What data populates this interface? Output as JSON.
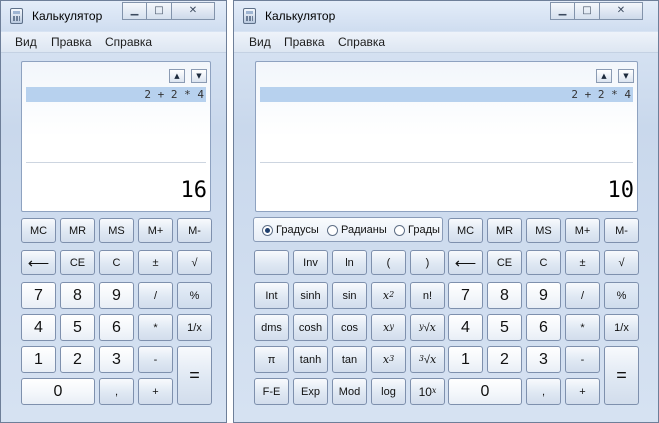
{
  "windows": [
    {
      "title": "Калькулятор",
      "menu": [
        "Вид",
        "Правка",
        "Справка"
      ],
      "display": {
        "history_up": "▲",
        "history_down": "▼",
        "history_expression": "2 + 2 * 4",
        "result": "16"
      },
      "keys": {
        "mc": "MC",
        "mr": "MR",
        "ms": "MS",
        "mplus": "M+",
        "mminus": "M-",
        "backspace": "⟵",
        "ce": "CE",
        "c": "C",
        "sign": "±",
        "sqrt": "√",
        "d7": "7",
        "d8": "8",
        "d9": "9",
        "div": "/",
        "pct": "%",
        "d4": "4",
        "d5": "5",
        "d6": "6",
        "mul": "*",
        "inv": "1/x",
        "d1": "1",
        "d2": "2",
        "d3": "3",
        "sub": "-",
        "eq": "=",
        "d0": "0",
        "dot": ",",
        "add": "+"
      }
    },
    {
      "title": "Калькулятор",
      "menu": [
        "Вид",
        "Правка",
        "Справка"
      ],
      "display": {
        "history_up": "▲",
        "history_down": "▼",
        "history_expression": "2 + 2 * 4",
        "result": "10"
      },
      "angle_modes": [
        "Градусы",
        "Радианы",
        "Грады"
      ],
      "selected_angle_mode": "Градусы",
      "sci_keys": {
        "inv": "Inv",
        "ln": "ln",
        "lparen": "(",
        "rparen": ")",
        "int": "Int",
        "sinh": "sinh",
        "sin": "sin",
        "sq_base": "x",
        "sq_exp": "2",
        "fact": "n!",
        "dms": "dms",
        "cosh": "cosh",
        "cos": "cos",
        "pow_base": "x",
        "pow_exp": "y",
        "yroot_idx": "y",
        "yroot_base": "x",
        "pi": "π",
        "tanh": "tanh",
        "tan": "tan",
        "cube_base": "x",
        "cube_exp": "3",
        "croot_idx": "3",
        "croot_base": "x",
        "fe": "F-E",
        "exp": "Exp",
        "mod": "Mod",
        "log": "log",
        "tenx_base": "10",
        "tenx_exp": "x"
      },
      "keys": {
        "mc": "MC",
        "mr": "MR",
        "ms": "MS",
        "mplus": "M+",
        "mminus": "M-",
        "backspace": "⟵",
        "ce": "CE",
        "c": "C",
        "sign": "±",
        "sqrt": "√",
        "d7": "7",
        "d8": "8",
        "d9": "9",
        "div": "/",
        "pct": "%",
        "d4": "4",
        "d5": "5",
        "d6": "6",
        "mul": "*",
        "inv": "1/x",
        "d1": "1",
        "d2": "2",
        "d3": "3",
        "sub": "-",
        "eq": "=",
        "d0": "0",
        "dot": ",",
        "add": "+"
      }
    }
  ],
  "window_controls": {
    "minimize": "▁",
    "maximize": "□",
    "close": "✕"
  }
}
